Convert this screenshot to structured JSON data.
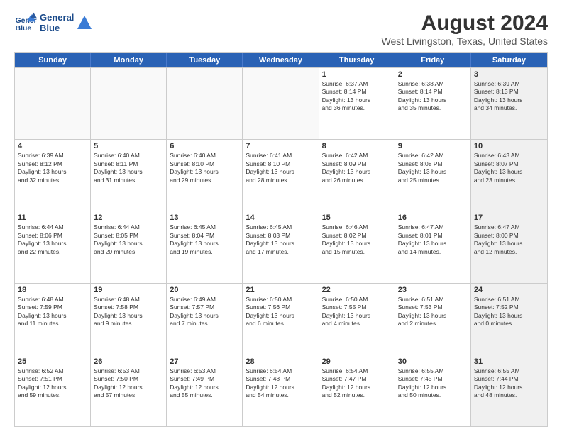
{
  "logo": {
    "line1": "General",
    "line2": "Blue"
  },
  "title": "August 2024",
  "subtitle": "West Livingston, Texas, United States",
  "days": [
    "Sunday",
    "Monday",
    "Tuesday",
    "Wednesday",
    "Thursday",
    "Friday",
    "Saturday"
  ],
  "rows": [
    [
      {
        "day": "",
        "info": "",
        "empty": true
      },
      {
        "day": "",
        "info": "",
        "empty": true
      },
      {
        "day": "",
        "info": "",
        "empty": true
      },
      {
        "day": "",
        "info": "",
        "empty": true
      },
      {
        "day": "1",
        "info": "Sunrise: 6:37 AM\nSunset: 8:14 PM\nDaylight: 13 hours\nand 36 minutes."
      },
      {
        "day": "2",
        "info": "Sunrise: 6:38 AM\nSunset: 8:14 PM\nDaylight: 13 hours\nand 35 minutes."
      },
      {
        "day": "3",
        "info": "Sunrise: 6:39 AM\nSunset: 8:13 PM\nDaylight: 13 hours\nand 34 minutes.",
        "shaded": true
      }
    ],
    [
      {
        "day": "4",
        "info": "Sunrise: 6:39 AM\nSunset: 8:12 PM\nDaylight: 13 hours\nand 32 minutes."
      },
      {
        "day": "5",
        "info": "Sunrise: 6:40 AM\nSunset: 8:11 PM\nDaylight: 13 hours\nand 31 minutes."
      },
      {
        "day": "6",
        "info": "Sunrise: 6:40 AM\nSunset: 8:10 PM\nDaylight: 13 hours\nand 29 minutes."
      },
      {
        "day": "7",
        "info": "Sunrise: 6:41 AM\nSunset: 8:10 PM\nDaylight: 13 hours\nand 28 minutes."
      },
      {
        "day": "8",
        "info": "Sunrise: 6:42 AM\nSunset: 8:09 PM\nDaylight: 13 hours\nand 26 minutes."
      },
      {
        "day": "9",
        "info": "Sunrise: 6:42 AM\nSunset: 8:08 PM\nDaylight: 13 hours\nand 25 minutes."
      },
      {
        "day": "10",
        "info": "Sunrise: 6:43 AM\nSunset: 8:07 PM\nDaylight: 13 hours\nand 23 minutes.",
        "shaded": true
      }
    ],
    [
      {
        "day": "11",
        "info": "Sunrise: 6:44 AM\nSunset: 8:06 PM\nDaylight: 13 hours\nand 22 minutes."
      },
      {
        "day": "12",
        "info": "Sunrise: 6:44 AM\nSunset: 8:05 PM\nDaylight: 13 hours\nand 20 minutes."
      },
      {
        "day": "13",
        "info": "Sunrise: 6:45 AM\nSunset: 8:04 PM\nDaylight: 13 hours\nand 19 minutes."
      },
      {
        "day": "14",
        "info": "Sunrise: 6:45 AM\nSunset: 8:03 PM\nDaylight: 13 hours\nand 17 minutes."
      },
      {
        "day": "15",
        "info": "Sunrise: 6:46 AM\nSunset: 8:02 PM\nDaylight: 13 hours\nand 15 minutes."
      },
      {
        "day": "16",
        "info": "Sunrise: 6:47 AM\nSunset: 8:01 PM\nDaylight: 13 hours\nand 14 minutes."
      },
      {
        "day": "17",
        "info": "Sunrise: 6:47 AM\nSunset: 8:00 PM\nDaylight: 13 hours\nand 12 minutes.",
        "shaded": true
      }
    ],
    [
      {
        "day": "18",
        "info": "Sunrise: 6:48 AM\nSunset: 7:59 PM\nDaylight: 13 hours\nand 11 minutes."
      },
      {
        "day": "19",
        "info": "Sunrise: 6:48 AM\nSunset: 7:58 PM\nDaylight: 13 hours\nand 9 minutes."
      },
      {
        "day": "20",
        "info": "Sunrise: 6:49 AM\nSunset: 7:57 PM\nDaylight: 13 hours\nand 7 minutes."
      },
      {
        "day": "21",
        "info": "Sunrise: 6:50 AM\nSunset: 7:56 PM\nDaylight: 13 hours\nand 6 minutes."
      },
      {
        "day": "22",
        "info": "Sunrise: 6:50 AM\nSunset: 7:55 PM\nDaylight: 13 hours\nand 4 minutes."
      },
      {
        "day": "23",
        "info": "Sunrise: 6:51 AM\nSunset: 7:53 PM\nDaylight: 13 hours\nand 2 minutes."
      },
      {
        "day": "24",
        "info": "Sunrise: 6:51 AM\nSunset: 7:52 PM\nDaylight: 13 hours\nand 0 minutes.",
        "shaded": true
      }
    ],
    [
      {
        "day": "25",
        "info": "Sunrise: 6:52 AM\nSunset: 7:51 PM\nDaylight: 12 hours\nand 59 minutes."
      },
      {
        "day": "26",
        "info": "Sunrise: 6:53 AM\nSunset: 7:50 PM\nDaylight: 12 hours\nand 57 minutes."
      },
      {
        "day": "27",
        "info": "Sunrise: 6:53 AM\nSunset: 7:49 PM\nDaylight: 12 hours\nand 55 minutes."
      },
      {
        "day": "28",
        "info": "Sunrise: 6:54 AM\nSunset: 7:48 PM\nDaylight: 12 hours\nand 54 minutes."
      },
      {
        "day": "29",
        "info": "Sunrise: 6:54 AM\nSunset: 7:47 PM\nDaylight: 12 hours\nand 52 minutes."
      },
      {
        "day": "30",
        "info": "Sunrise: 6:55 AM\nSunset: 7:45 PM\nDaylight: 12 hours\nand 50 minutes."
      },
      {
        "day": "31",
        "info": "Sunrise: 6:55 AM\nSunset: 7:44 PM\nDaylight: 12 hours\nand 48 minutes.",
        "shaded": true
      }
    ]
  ]
}
